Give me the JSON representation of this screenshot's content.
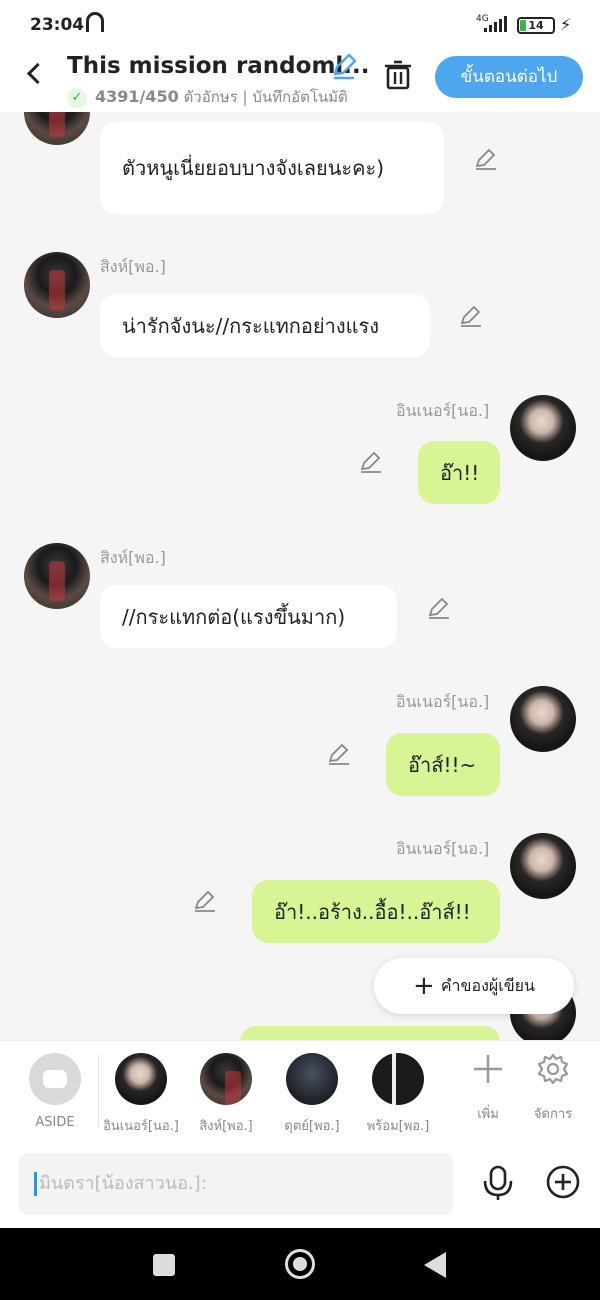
{
  "status_bar": {
    "time": "23:04",
    "network": "4G",
    "battery": "14"
  },
  "header": {
    "title": "This mission randoml...",
    "char_count": "4391/450",
    "meta": "ตัวอักษร | บันทึกอัตโนมัติ",
    "next_button": "ขั้นตอนต่อไป"
  },
  "messages": [
    {
      "side": "left",
      "name": "",
      "text": "ตัวหนูเนี่ยยอบบางจังเลยนะคะ)",
      "avatar": "guy"
    },
    {
      "side": "left",
      "name": "สิงห์[พอ.]",
      "text": "น่ารักจังนะ//กระแทกอย่างแรง",
      "avatar": "guy"
    },
    {
      "side": "right",
      "name": "อินเนอร์[นอ.]",
      "text": "อ๊า!!",
      "avatar": "boy"
    },
    {
      "side": "left",
      "name": "สิงห์[พอ.]",
      "text": "//กระแทกต่อ(แรงขึ้นมาก)",
      "avatar": "guy"
    },
    {
      "side": "right",
      "name": "อินเนอร์[นอ.]",
      "text": "อ๊าส์!!~",
      "avatar": "boy"
    },
    {
      "side": "right",
      "name": "อินเนอร์[นอ.]",
      "text": "อ๊า!..อร้าง..อื้อ!..อ๊าส์!!",
      "avatar": "boy"
    }
  ],
  "fab": {
    "label": "คำของผู้เขียน",
    "icon": "plus-icon"
  },
  "characters": [
    {
      "label": "ASIDE",
      "type": "aside"
    },
    {
      "label": "อินเนอร์[นอ.]",
      "type": "boy"
    },
    {
      "label": "สิงห์[พอ.]",
      "type": "guy"
    },
    {
      "label": "ดุตย์[พอ.]",
      "type": "dark"
    },
    {
      "label": "พร้อม[พอ.]",
      "type": "suit"
    }
  ],
  "tools": {
    "add_label": "เพิ่ม",
    "manage_label": "จัดการ"
  },
  "input": {
    "placeholder": "มินตรา[น้องสาวนอ.]:"
  },
  "colors": {
    "accent": "#4ea7ee",
    "bubble_right": "#d8f595",
    "bubble_left": "#ffffff"
  }
}
